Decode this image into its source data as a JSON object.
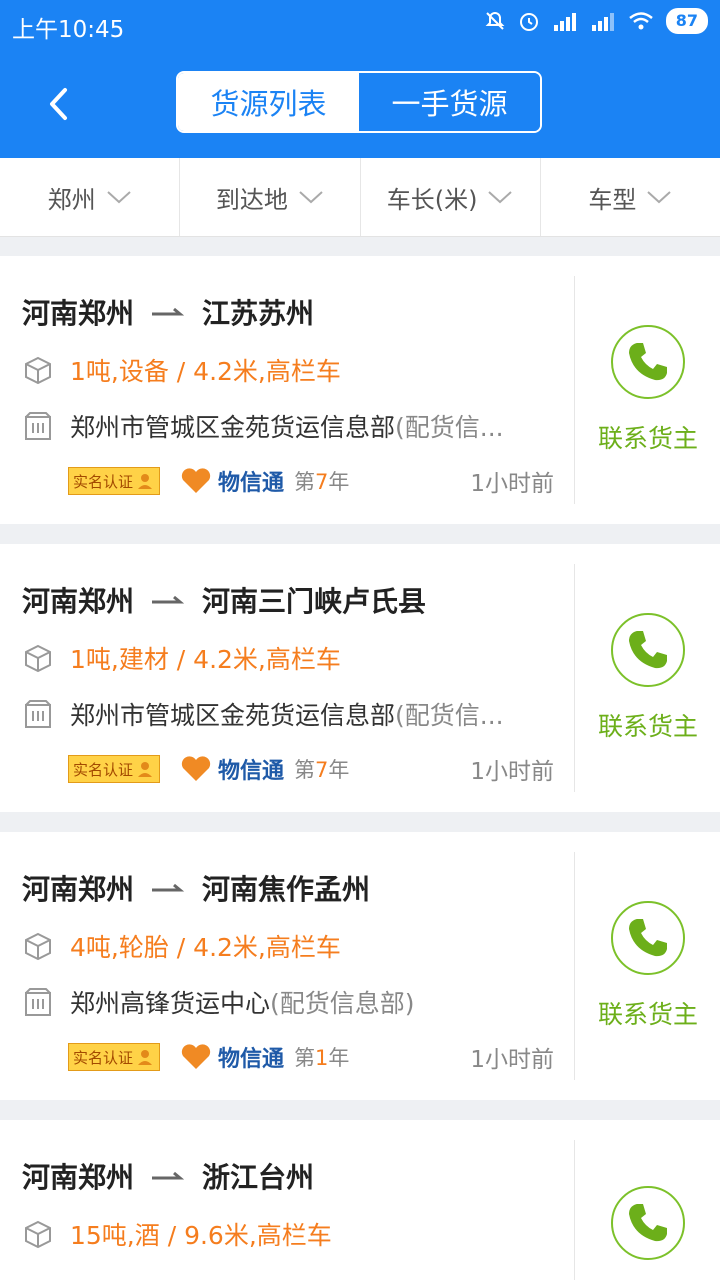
{
  "status": {
    "time": "上午10:45",
    "battery": "87"
  },
  "header": {
    "tabs": [
      {
        "label": "货源列表",
        "active": true
      },
      {
        "label": "一手货源",
        "active": false
      }
    ]
  },
  "filters": [
    {
      "label": "郑州"
    },
    {
      "label": "到达地"
    },
    {
      "label": "车长(米)"
    },
    {
      "label": "车型"
    }
  ],
  "cards": [
    {
      "from": "河南郑州",
      "to": "江苏苏州",
      "goods": "1吨,设备 / 4.2米,高栏车",
      "company": "郑州市管城区金苑货运信息部",
      "company_sub": "(配货信...",
      "badge": "实名认证",
      "brand": "物信通",
      "years_prefix": "第",
      "years": "7",
      "years_suffix": "年",
      "time_ago": "1小时前",
      "contact": "联系货主"
    },
    {
      "from": "河南郑州",
      "to": "河南三门峡卢氏县",
      "goods": "1吨,建材 / 4.2米,高栏车",
      "company": "郑州市管城区金苑货运信息部",
      "company_sub": "(配货信...",
      "badge": "实名认证",
      "brand": "物信通",
      "years_prefix": "第",
      "years": "7",
      "years_suffix": "年",
      "time_ago": "1小时前",
      "contact": "联系货主"
    },
    {
      "from": "河南郑州",
      "to": "河南焦作孟州",
      "goods": "4吨,轮胎 / 4.2米,高栏车",
      "company": "郑州高锋货运中心",
      "company_sub": "(配货信息部)",
      "badge": "实名认证",
      "brand": "物信通",
      "years_prefix": "第",
      "years": "1",
      "years_suffix": "年",
      "time_ago": "1小时前",
      "contact": "联系货主"
    },
    {
      "from": "河南郑州",
      "to": "浙江台州",
      "goods": "15吨,酒 / 9.6米,高栏车",
      "contact": ""
    }
  ]
}
